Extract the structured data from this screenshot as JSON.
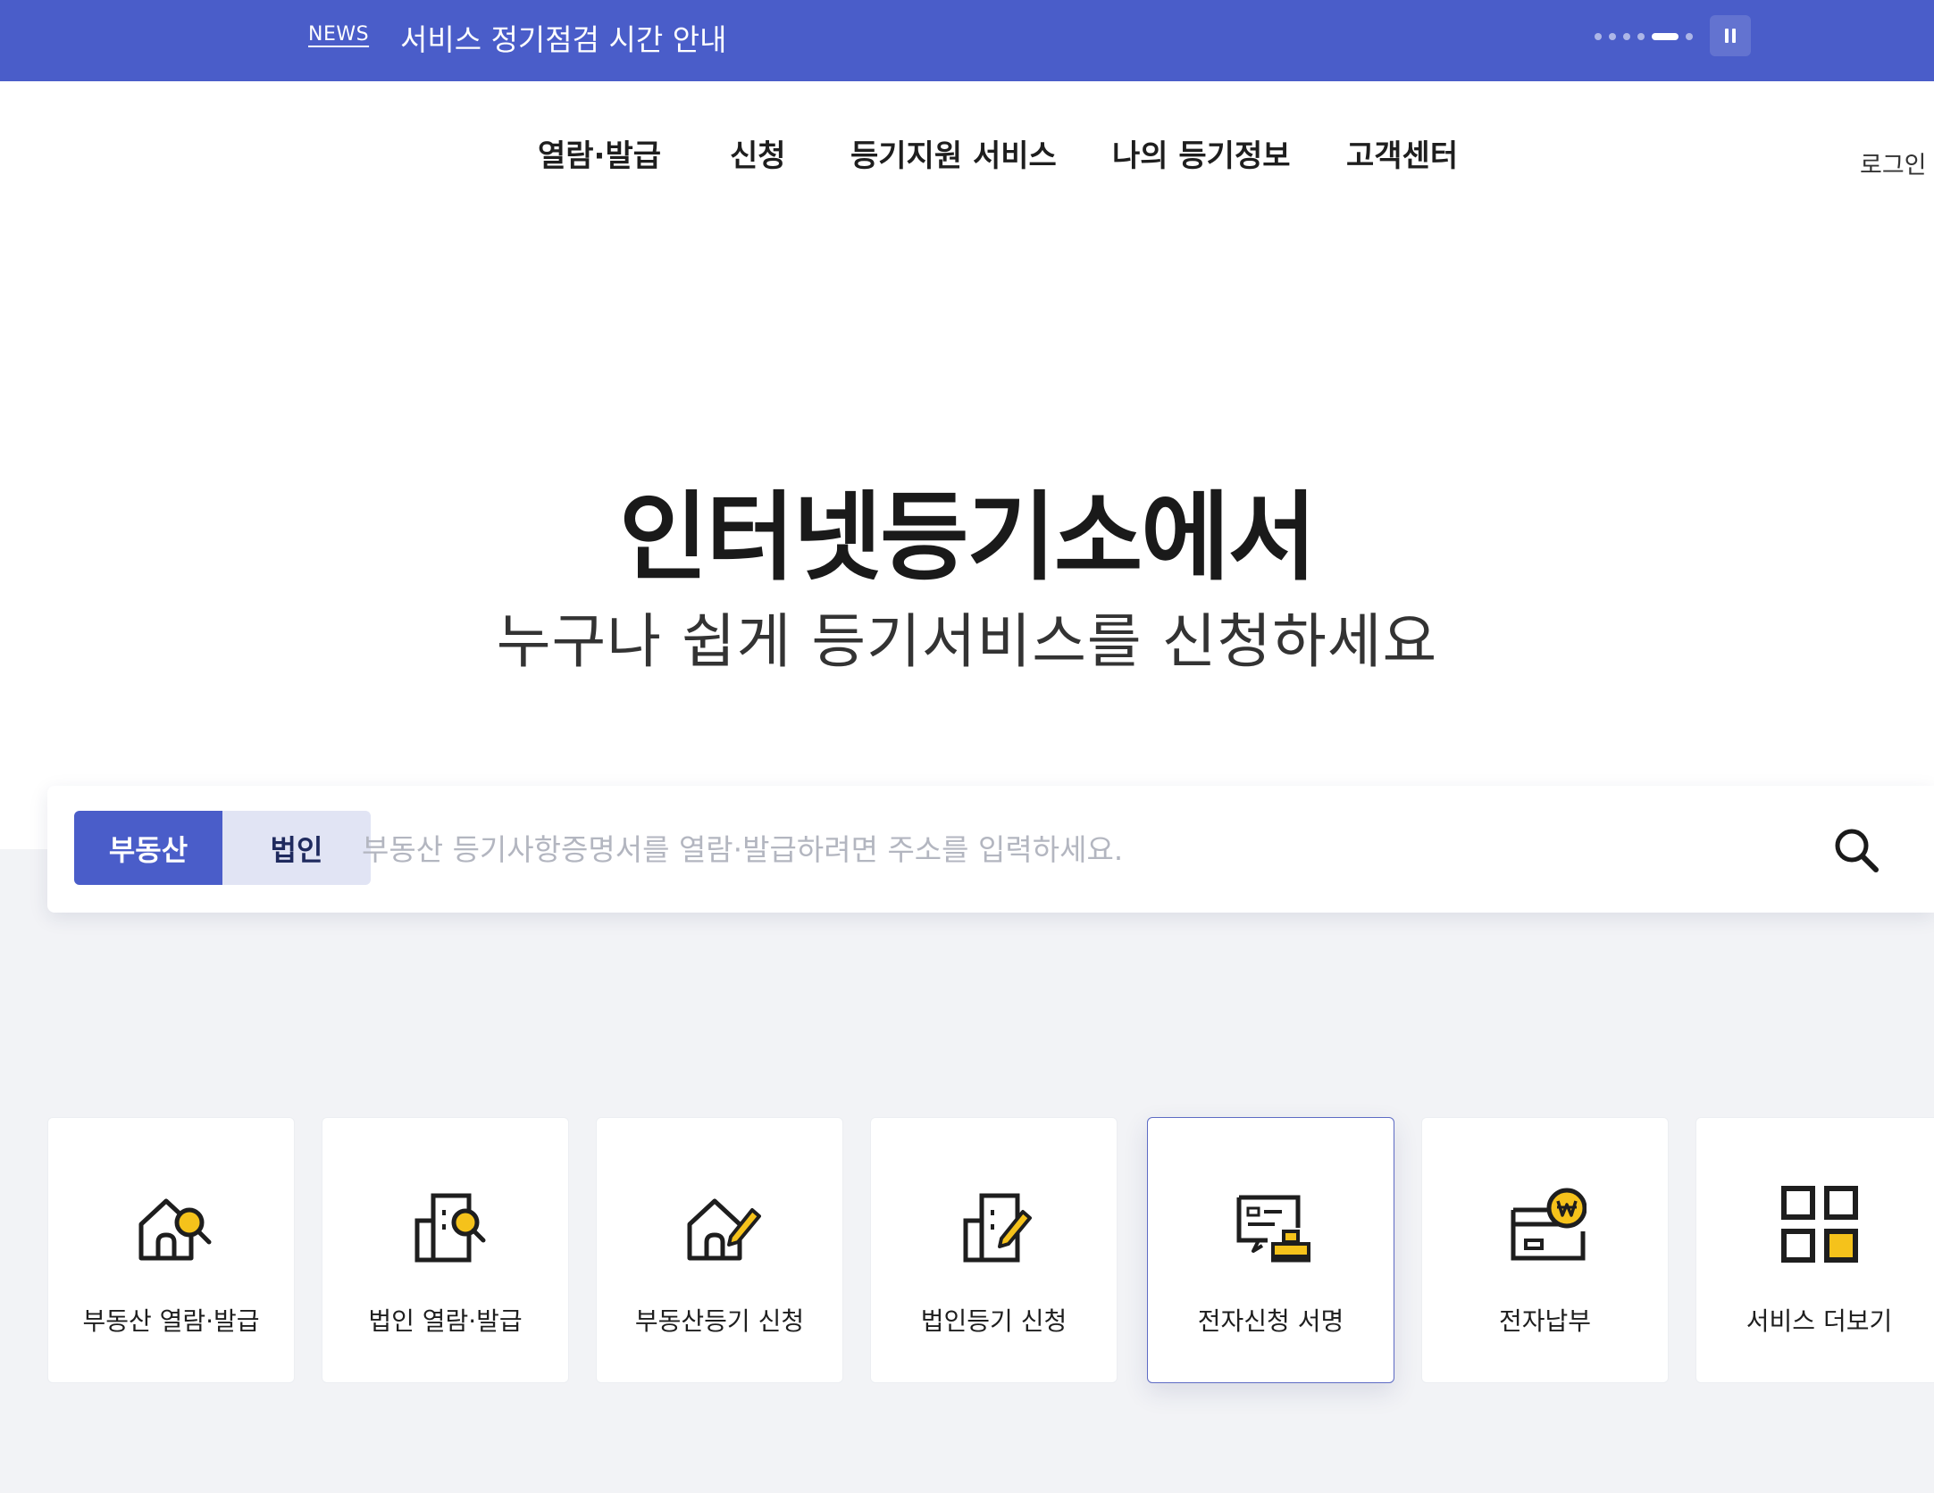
{
  "news": {
    "tag": "NEWS",
    "title": "서비스 정기점검 시간 안내",
    "dots_total": 6,
    "dots_active_index": 4,
    "pause_icon": "pause-icon"
  },
  "nav": {
    "items": [
      {
        "label": "열람·발급"
      },
      {
        "label": "신청"
      },
      {
        "label": "등기지원 서비스"
      },
      {
        "label": "나의 등기정보"
      },
      {
        "label": "고객센터"
      }
    ],
    "login_label": "로그인"
  },
  "hero": {
    "title": "인터넷등기소에서",
    "subtitle": "누구나 쉽게 등기서비스를 신청하세요"
  },
  "search": {
    "tabs": [
      {
        "label": "부동산",
        "selected": true
      },
      {
        "label": "법인",
        "selected": false
      }
    ],
    "value": "",
    "placeholder": "부동산 등기사항증명서를 열람·발급하려면 주소를 입력하세요.",
    "icon": "search-icon"
  },
  "services": [
    {
      "label": "부동산 열람·발급",
      "icon": "house-search-icon"
    },
    {
      "label": "법인 열람·발급",
      "icon": "building-search-icon"
    },
    {
      "label": "부동산등기 신청",
      "icon": "house-pen-icon"
    },
    {
      "label": "법인등기 신청",
      "icon": "building-pen-icon"
    },
    {
      "label": "전자신청 서명",
      "icon": "certificate-stamp-icon",
      "selected": true
    },
    {
      "label": "전자납부",
      "icon": "card-won-icon"
    },
    {
      "label": "서비스 더보기",
      "icon": "grid-more-icon"
    }
  ],
  "colors": {
    "brand": "#4a5dc9",
    "accent_yellow": "#f5c21b",
    "tab_inactive": "#e1e4f4",
    "section_bg": "#f2f3f6"
  }
}
